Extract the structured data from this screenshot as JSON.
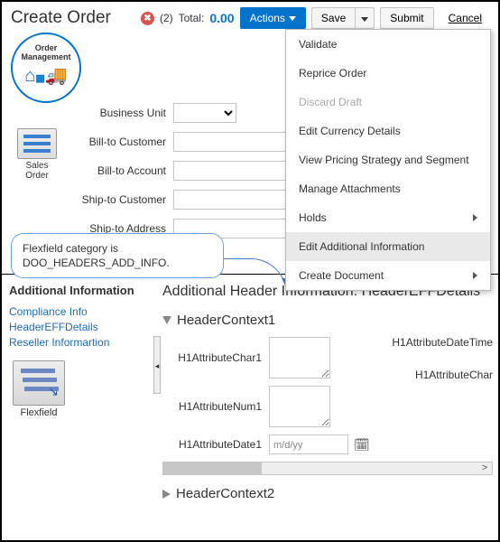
{
  "header": {
    "title": "Create Order",
    "error_count": "(2)",
    "total_label": "Total:",
    "total_value": "0.00",
    "actions_label": "Actions",
    "save_label": "Save",
    "submit_label": "Submit",
    "cancel_label": "Cancel"
  },
  "om_circle": "Order Management",
  "sales_order_label": "Sales Order",
  "form": {
    "business_unit": "Business Unit",
    "bill_to_customer": "Bill-to Customer",
    "bill_to_account": "Bill-to Account",
    "ship_to_customer": "Ship-to Customer",
    "ship_to_address": "Ship-to Address"
  },
  "actions_menu": {
    "validate": "Validate",
    "reprice": "Reprice Order",
    "discard": "Discard Draft",
    "edit_currency": "Edit Currency Details",
    "view_pricing": "View Pricing Strategy and Segment",
    "manage_attach": "Manage Attachments",
    "holds": "Holds",
    "edit_additional": "Edit Additional Information",
    "create_doc": "Create Document"
  },
  "callout_text": "Flexfield category is DOO_HEADERS_ADD_INFO.",
  "bottom": {
    "side_heading": "Additional Information",
    "links": {
      "compliance": "Compliance Info",
      "headereff": "HeaderEFFDetails",
      "reseller": "Reseller Informartion"
    },
    "flexfield_label": "Flexfield",
    "main_heading": "Additional Header Information: HeaderEFFDetails",
    "ctx1": "HeaderContext1",
    "attr_char1": "H1AttributeChar1",
    "attr_num1": "H1AttributeNum1",
    "attr_date1": "H1AttributeDate1",
    "date_placeholder": "m/d/yy",
    "attr_datetime_lbl": "H1AttributeDateTime",
    "attr_char_lbl": "H1AttributeChar",
    "ctx2": "HeaderContext2"
  }
}
